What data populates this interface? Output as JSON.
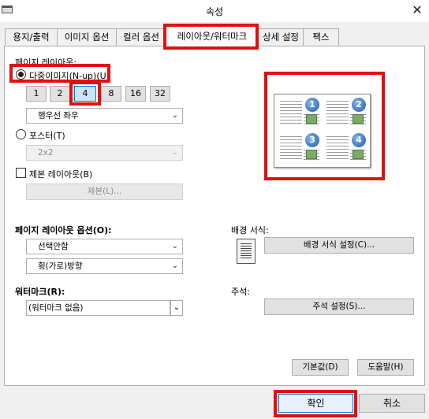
{
  "window": {
    "title": "속성",
    "close_glyph": "✕"
  },
  "tabs": [
    {
      "label": "용지/출력"
    },
    {
      "label": "이미지 옵션"
    },
    {
      "label": "컬러 옵션"
    },
    {
      "label": "레이아웃/워터마크"
    },
    {
      "label": "상세 설정"
    },
    {
      "label": "팩스"
    }
  ],
  "layout": {
    "section_label": "페이지 레이아웃:",
    "nup": {
      "label": "다중이미지(N-up)(U)",
      "checked": true
    },
    "nup_counts": [
      "1",
      "2",
      "4",
      "8",
      "16",
      "32"
    ],
    "nup_selected": "4",
    "order_select": "행우선 좌우",
    "poster": {
      "label": "포스터(T)",
      "checked": false
    },
    "poster_select": "2x2",
    "booklet": {
      "label": "제본 레이아웃(B)",
      "checked": false
    },
    "booklet_button": "제본(L)...",
    "preview_numbers": [
      "1",
      "2",
      "3",
      "4"
    ]
  },
  "layout_options": {
    "label": "페이지 레이아웃 옵션(O):",
    "select1": "선택안함",
    "select2": "횡(가로)방향"
  },
  "background": {
    "label": "배경 서식:",
    "button": "배경 서식 설정(C)..."
  },
  "watermark": {
    "label": "워터마크(R):",
    "select": "(워터마크 없음)"
  },
  "annotation": {
    "label": "주석:",
    "button": "주석 설정(S)..."
  },
  "footer": {
    "defaults_button": "기본값(D)",
    "help_button": "도움말(H)",
    "ok_button": "확인",
    "cancel_button": "취소"
  },
  "colors": {
    "highlight": "#e01010",
    "selected_fill": "#cce4f7",
    "selected_border": "#0078d7"
  }
}
